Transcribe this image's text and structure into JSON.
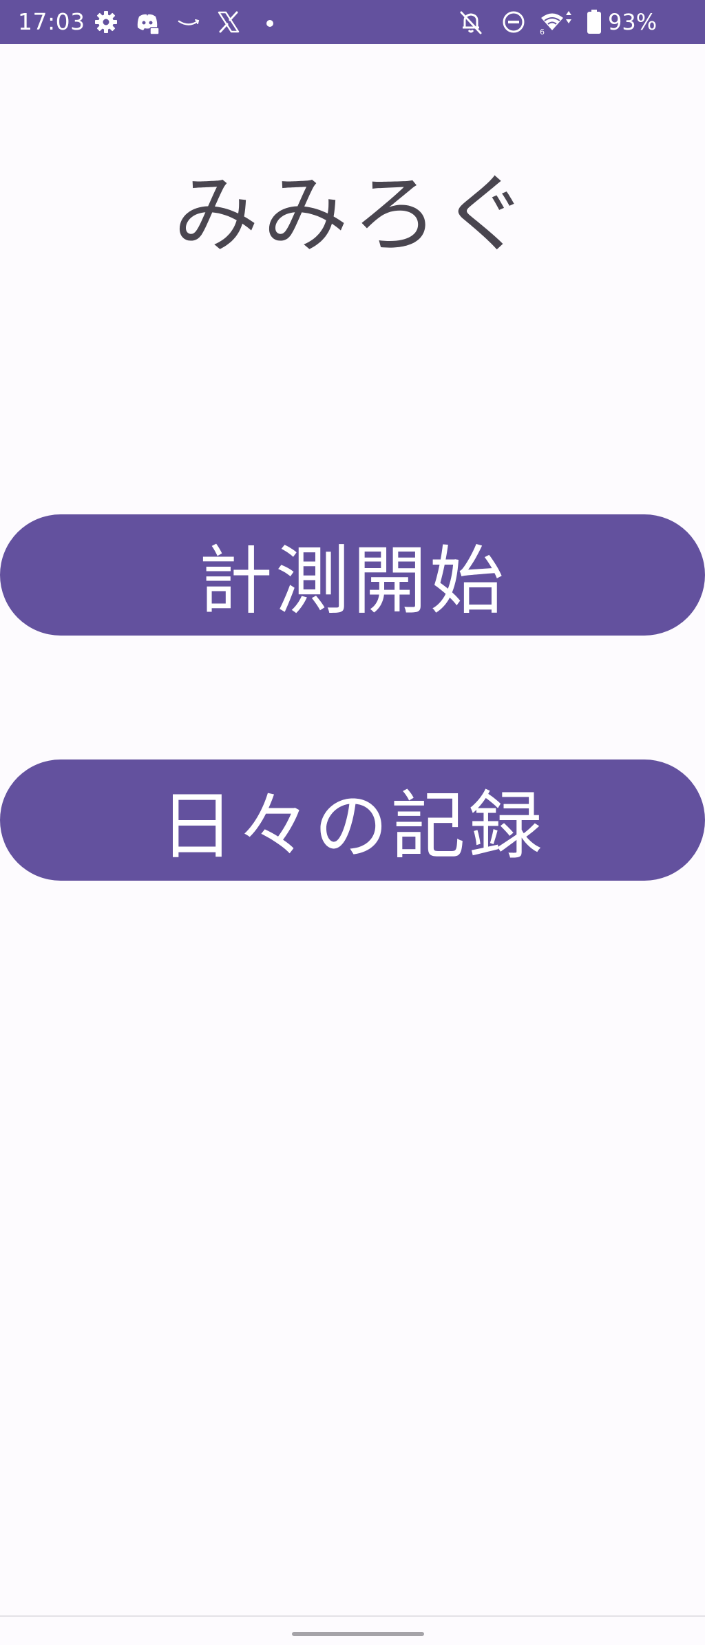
{
  "status_bar": {
    "time": "17:03",
    "battery_percent": "93%",
    "background_color": "#63519e",
    "left_icons": [
      "gear-icon",
      "discord-icon",
      "amazon-icon",
      "x-icon",
      "dot-icon"
    ],
    "right_icons": [
      "notifications-off-icon",
      "do-not-disturb-icon",
      "wifi-icon",
      "battery-icon"
    ]
  },
  "app": {
    "title": "みみろぐ",
    "title_color": "#49454f",
    "background_color": "#fdfbfe"
  },
  "buttons": {
    "start_measurement": "計測開始",
    "daily_records": "日々の記録",
    "color": "#63519e",
    "text_color": "#ffffff"
  }
}
